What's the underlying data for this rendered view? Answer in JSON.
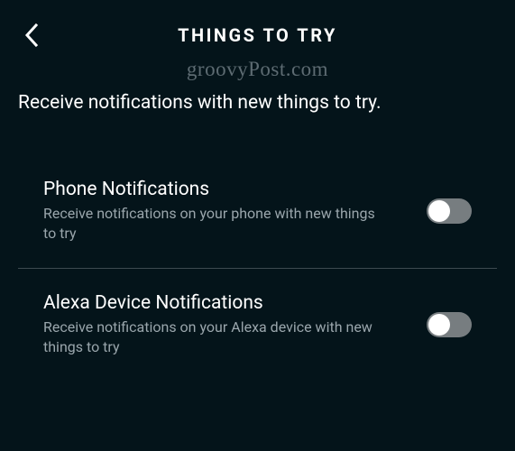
{
  "header": {
    "title": "THINGS TO TRY"
  },
  "watermark": "groovyPost.com",
  "subheading": "Receive notifications with new things to try.",
  "settings": [
    {
      "title": "Phone Notifications",
      "description": "Receive notifications on your phone with new things to try",
      "enabled": false
    },
    {
      "title": "Alexa Device Notifications",
      "description": "Receive notifications on your Alexa device with new things to try",
      "enabled": false
    }
  ]
}
